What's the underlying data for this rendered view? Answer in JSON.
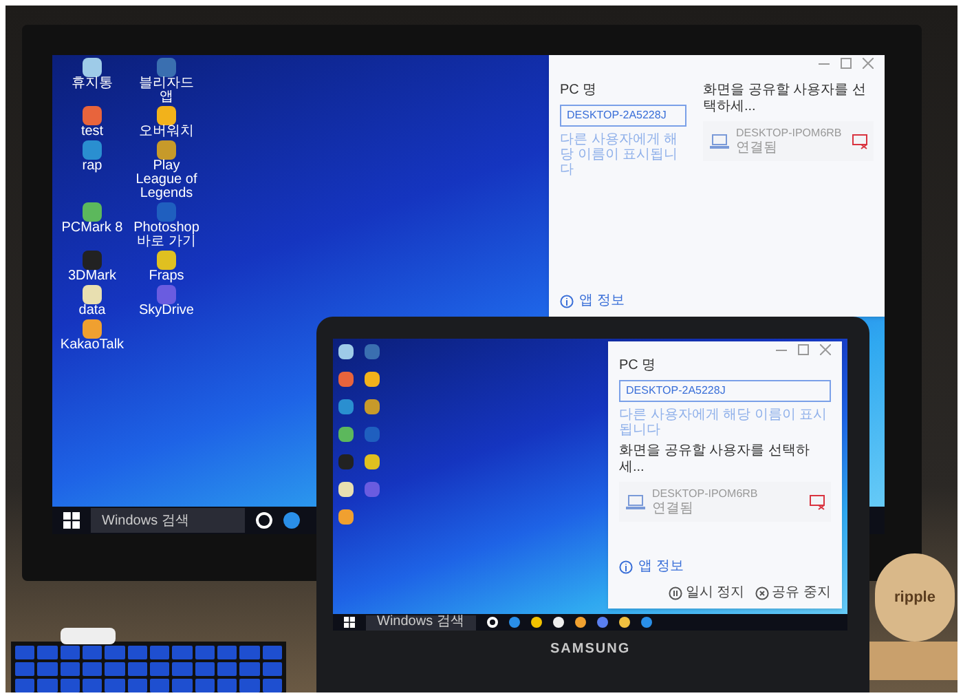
{
  "monitor": {
    "desktop_icons": [
      "휴지통",
      "블리자드 앱",
      "test",
      "오버워치",
      "rap",
      "Play League of Legends",
      "PCMark 8",
      "Photoshop 바로 가기",
      "3DMark",
      "Fraps",
      "data",
      "SkyDrive",
      "KakaoTalk"
    ],
    "dialog": {
      "pc_name_label": "PC 명",
      "pc_name": "DESKTOP-2A5228J",
      "hint": "다른 사용자에게 해당 이름이 표시됩니다",
      "share_title": "화면을 공유할 사용자를 선택하세...",
      "device": {
        "name": "DESKTOP-IPOM6RB",
        "status": "연결됨"
      },
      "app_info": "앱 정보"
    },
    "taskbar": {
      "search_placeholder": "Windows 검색"
    }
  },
  "laptop": {
    "dialog": {
      "pc_name_label": "PC 명",
      "pc_name": "DESKTOP-2A5228J",
      "hint": "다른 사용자에게 해당 이름이 표시됩니다",
      "share_title": "화면을 공유할 사용자를 선택하세...",
      "device": {
        "name": "DESKTOP-IPOM6RB",
        "status": "연결됨"
      },
      "app_info": "앱 정보",
      "buttons": [
        "일시 정지",
        "공유 중지"
      ]
    },
    "taskbar": {
      "search_placeholder": "Windows 검색"
    },
    "brand": "SAMSUNG"
  },
  "stand_sign": "ripple"
}
